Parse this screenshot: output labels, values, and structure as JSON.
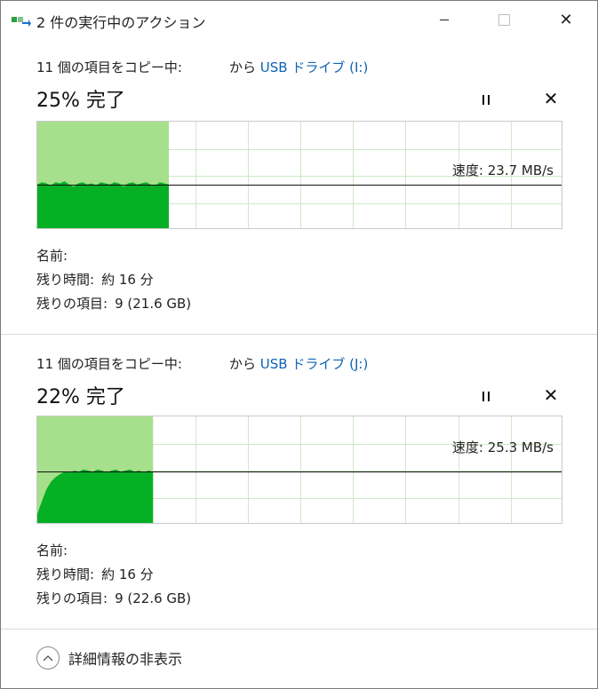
{
  "window": {
    "title": "2 件の実行中のアクション",
    "app_icon": "copy-arrow-icon",
    "close_glyph": "✕"
  },
  "operations": [
    {
      "copy_text": "11 個の項目をコピー中:",
      "from_text": "から",
      "destination": "USB ドライブ (I:)",
      "percent_text": "25% 完了",
      "progress": 0.25,
      "speed_text": "速度: 23.7 MB/s",
      "cancel_glyph": "✕",
      "name_label": "名前:",
      "name_value": "",
      "time_label": "残り時間:",
      "time_value": "約 16 分",
      "items_label": "残りの項目:",
      "items_value": "9 (21.6 GB)",
      "speed_samples": [
        0.42,
        0.44,
        0.43,
        0.41,
        0.44,
        0.43,
        0.45,
        0.42,
        0.4,
        0.43,
        0.44,
        0.42,
        0.43,
        0.41,
        0.44,
        0.43,
        0.42,
        0.44,
        0.43,
        0.4,
        0.43,
        0.44,
        0.42,
        0.43,
        0.44,
        0.42,
        0.41,
        0.44,
        0.43,
        0.42
      ]
    },
    {
      "copy_text": "11 個の項目をコピー中:",
      "from_text": "から",
      "destination": "USB ドライブ (J:)",
      "percent_text": "22% 完了",
      "progress": 0.22,
      "speed_text": "速度: 25.3 MB/s",
      "cancel_glyph": "✕",
      "name_label": "名前:",
      "name_value": "",
      "time_label": "残り時間:",
      "time_value": "約 16 分",
      "items_label": "残りの項目:",
      "items_value": "9 (22.6 GB)",
      "speed_samples": [
        0.1,
        0.22,
        0.33,
        0.4,
        0.44,
        0.47,
        0.49,
        0.48,
        0.5,
        0.49,
        0.51,
        0.5,
        0.49,
        0.51,
        0.5,
        0.48,
        0.5,
        0.51,
        0.49,
        0.5,
        0.51,
        0.49,
        0.5,
        0.48,
        0.5,
        0.49
      ]
    }
  ],
  "footer": {
    "toggle_label": "詳細情報の非表示"
  },
  "colors": {
    "progress_fill": "#a6e08c",
    "speed_fill": "#06b025",
    "grid": "#cfe8c8",
    "link": "#0e63b5"
  }
}
